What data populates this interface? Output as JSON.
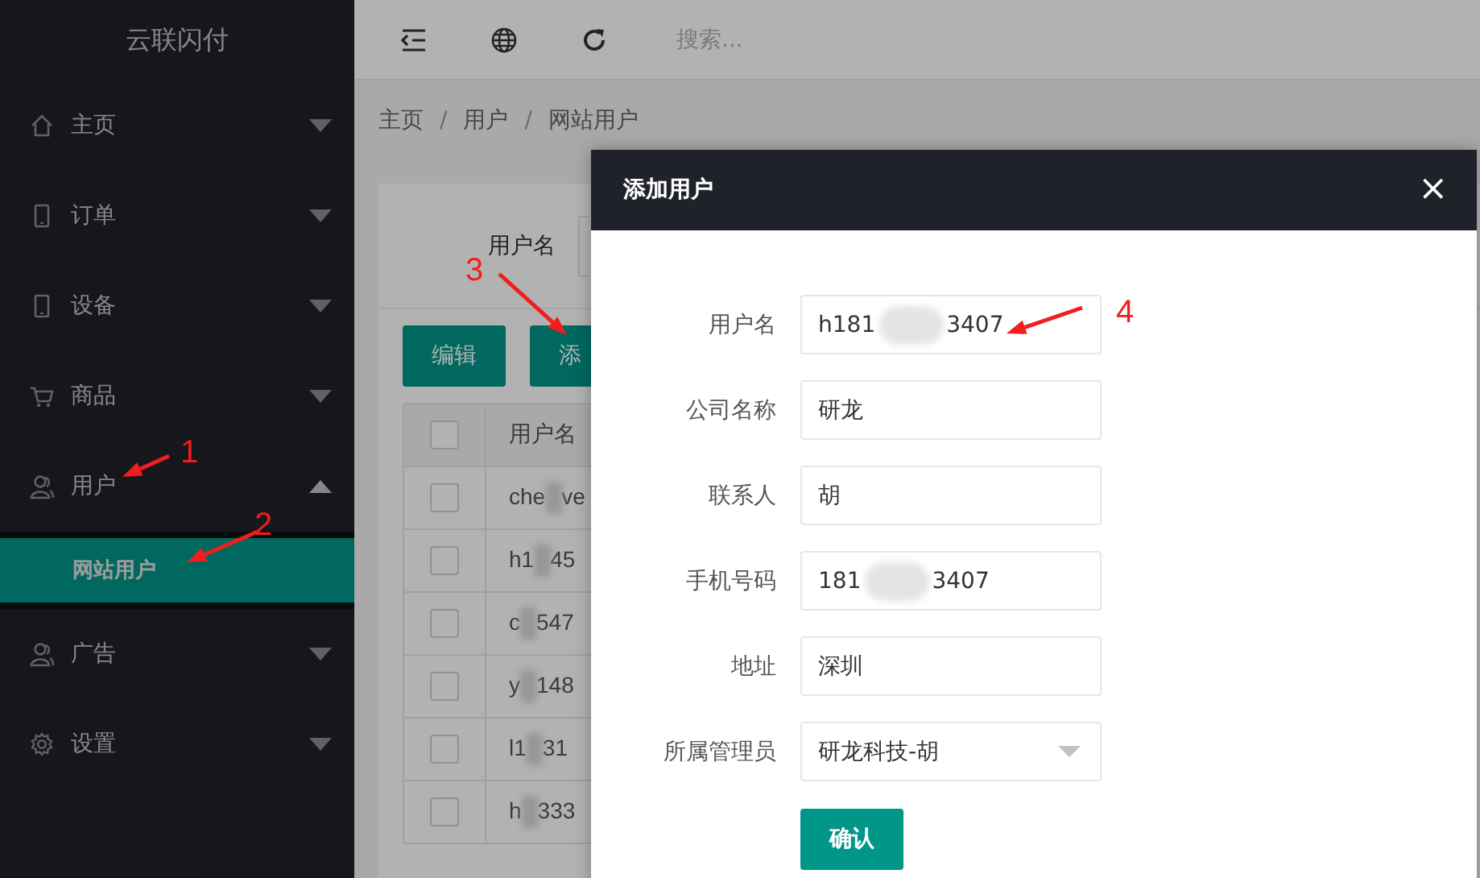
{
  "sidebar": {
    "logo": "云联闪付",
    "items": [
      {
        "label": "主页",
        "kind": "home",
        "expanded": false
      },
      {
        "label": "订单",
        "kind": "device",
        "expanded": false
      },
      {
        "label": "设备",
        "kind": "device",
        "expanded": false
      },
      {
        "label": "商品",
        "kind": "cart",
        "expanded": false
      },
      {
        "label": "用户",
        "kind": "user",
        "expanded": true,
        "children": [
          {
            "label": "网站用户",
            "selected": true
          }
        ]
      },
      {
        "label": "广告",
        "kind": "user",
        "expanded": false
      },
      {
        "label": "设置",
        "kind": "gear",
        "expanded": false
      }
    ]
  },
  "topbar": {
    "search": {
      "placeholder": "搜索..."
    }
  },
  "breadcrumb": {
    "items": [
      "主页",
      "用户",
      "网站用户"
    ],
    "separator": "/"
  },
  "filter": {
    "label": "用户名"
  },
  "buttons": [
    "编辑",
    "添"
  ],
  "table": {
    "columns": [
      "用户名"
    ],
    "header_checked": false,
    "rows": [
      {
        "checked": false,
        "text_start": "che",
        "text_end": "ve"
      },
      {
        "checked": false,
        "text_start": "h1",
        "text_end": "45"
      },
      {
        "checked": false,
        "text_start": "c",
        "text_end": "547"
      },
      {
        "checked": false,
        "text_start": "y",
        "text_end": "148"
      },
      {
        "checked": false,
        "text_start": "l1",
        "text_end": "31"
      },
      {
        "checked": false,
        "text_start": "h",
        "text_end": "333"
      }
    ]
  },
  "dialog": {
    "title": "添加用户",
    "close": "×",
    "fields": [
      {
        "label": "用户名",
        "kind": "text",
        "value_start": "h181",
        "value_end": "3407",
        "blurred": true
      },
      {
        "label": "公司名称",
        "kind": "text",
        "value_start": "研龙",
        "blurred": false
      },
      {
        "label": "联系人",
        "kind": "text",
        "value_start": "胡",
        "blurred": false
      },
      {
        "label": "手机号码",
        "kind": "text",
        "value_start": "181",
        "value_end": "3407",
        "blurred": true
      },
      {
        "label": "地址",
        "kind": "text",
        "value_start": "深圳",
        "blurred": false
      },
      {
        "label": "所属管理员",
        "kind": "select",
        "value_start": "研龙科技-胡",
        "blurred": false
      }
    ],
    "confirm": "确认"
  },
  "annotations": [
    {
      "number": "1"
    },
    {
      "number": "2"
    },
    {
      "number": "3"
    },
    {
      "number": "4"
    }
  ]
}
